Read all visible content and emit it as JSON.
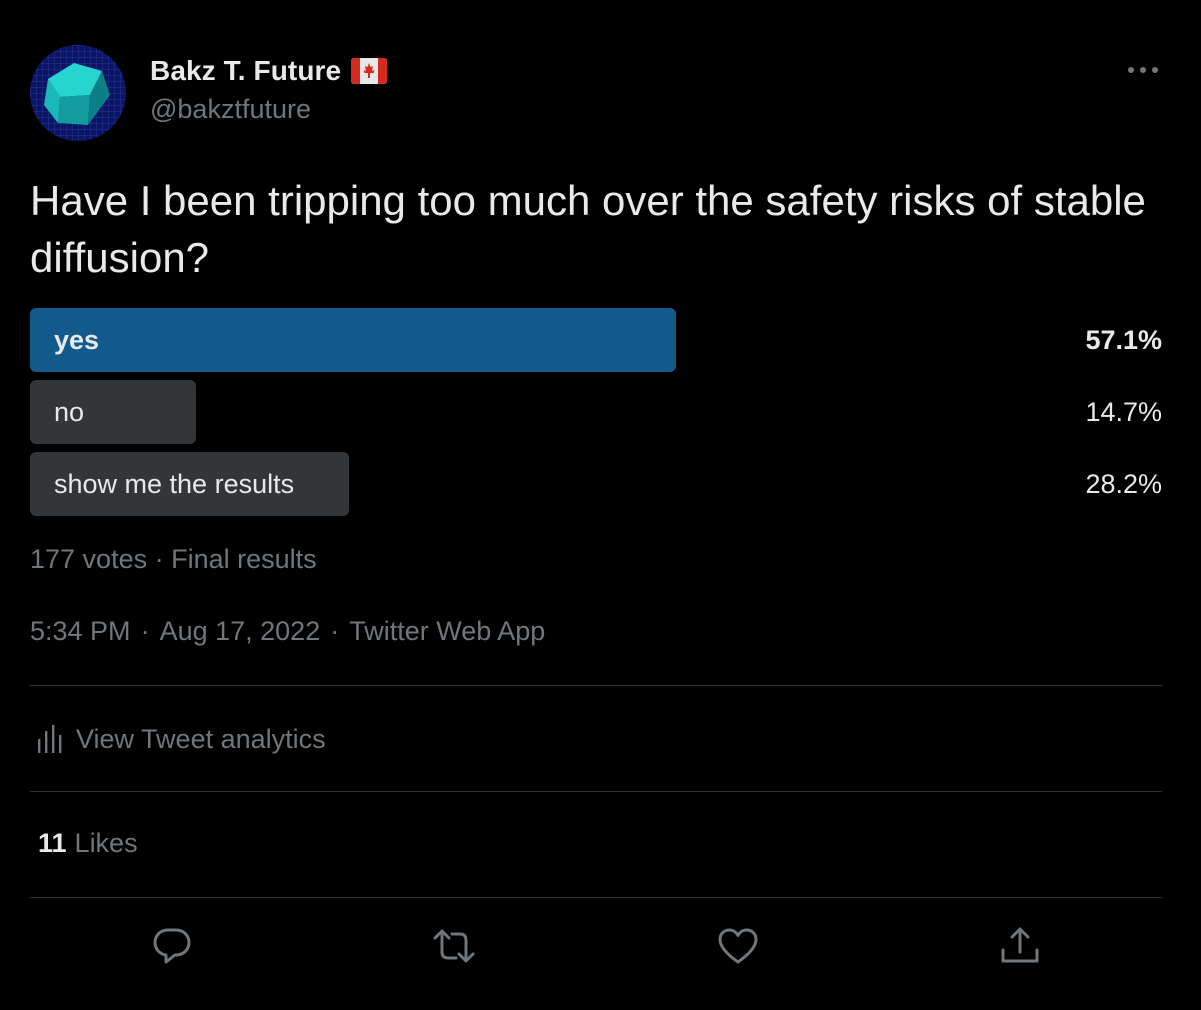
{
  "author": {
    "display_name": "Bakz T. Future",
    "handle": "@bakztfuture",
    "flag_icon": "canada-flag-icon",
    "avatar_icon": "cube-avatar-icon"
  },
  "more_icon": "more-horizontal-icon",
  "tweet": {
    "text": "Have I been tripping too much over the safety risks of stable diffusion?"
  },
  "poll": {
    "options": [
      {
        "label": "yes",
        "percent": "57.1%",
        "share": 0.571,
        "winner": true
      },
      {
        "label": "no",
        "percent": "14.7%",
        "share": 0.147,
        "winner": false
      },
      {
        "label": "show me the results",
        "percent": "28.2%",
        "share": 0.282,
        "winner": false
      }
    ],
    "votes": "177 votes",
    "status": "Final results",
    "separator": "·"
  },
  "timestamp": {
    "time": "5:34 PM",
    "date": "Aug 17, 2022",
    "source": "Twitter Web App",
    "separator": "·"
  },
  "analytics": {
    "label": "View Tweet analytics",
    "icon": "analytics-bars-icon"
  },
  "likes": {
    "count": "11",
    "label": "Likes"
  },
  "actions": [
    {
      "name": "reply",
      "icon": "reply-icon"
    },
    {
      "name": "retweet",
      "icon": "retweet-icon"
    },
    {
      "name": "like",
      "icon": "heart-icon"
    },
    {
      "name": "share",
      "icon": "share-icon"
    }
  ],
  "colors": {
    "background": "#000000",
    "text_primary": "#e7e9ea",
    "text_secondary": "#71767b",
    "poll_winner": "#135a8c",
    "poll_other": "#333639",
    "divider": "#2f3336"
  }
}
